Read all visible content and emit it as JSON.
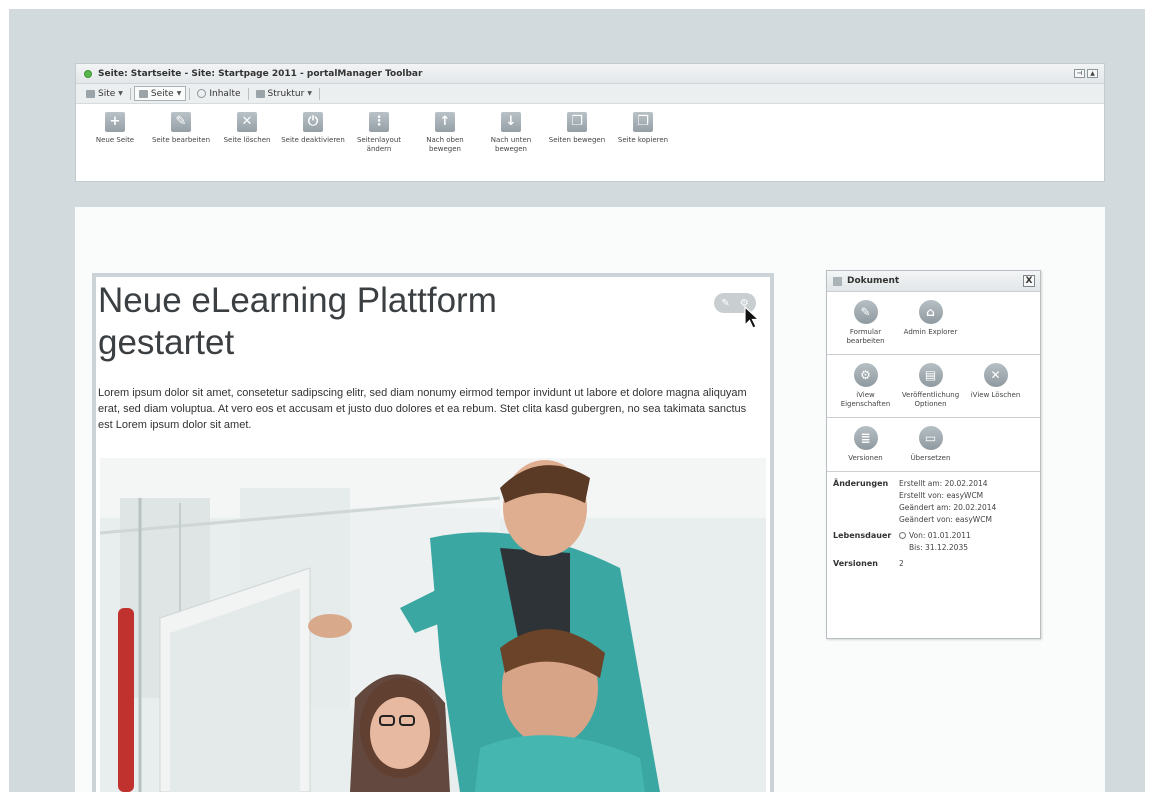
{
  "toolbar": {
    "title": "Seite: Startseite - Site: Startpage 2011 - portalManager Toolbar",
    "menu": {
      "site": "Site",
      "seite": "Seite",
      "inhalte": "Inhalte",
      "struktur": "Struktur"
    },
    "actions": [
      {
        "label": "Neue Seite",
        "icon": "plus-icon"
      },
      {
        "label": "Seite bearbeiten",
        "icon": "pencil-icon"
      },
      {
        "label": "Seite löschen",
        "icon": "x-icon"
      },
      {
        "label": "Seite deaktivieren",
        "icon": "power-icon"
      },
      {
        "label": "Seitenlayout ändern",
        "icon": "layout-icon"
      },
      {
        "label": "Nach oben bewegen",
        "icon": "arrow-up-icon"
      },
      {
        "label": "Nach unten bewegen",
        "icon": "arrow-down-icon"
      },
      {
        "label": "Seiten bewegen",
        "icon": "pages-icon"
      },
      {
        "label": "Seite kopieren",
        "icon": "copy-icon"
      }
    ]
  },
  "article": {
    "headline": "Neue eLearning Plattform gestartet",
    "body": "Lorem ipsum dolor sit amet, consetetur sadipscing elitr, sed diam nonumy eirmod tempor invidunt ut labore et dolore magna aliquyam erat, sed diam voluptua. At vero eos et accusam et justo duo dolores et ea rebum. Stet clita kasd gubergren, no sea takimata sanctus est Lorem ipsum dolor sit amet."
  },
  "dokument": {
    "title": "Dokument",
    "close": "X",
    "buttons_1": [
      {
        "label": "Formular bearbeiten",
        "icon": "pencil-circle-icon"
      },
      {
        "label": "Admin Explorer",
        "icon": "home-icon"
      }
    ],
    "buttons_2": [
      {
        "label": "iView Eigenschaften",
        "icon": "gear-icon"
      },
      {
        "label": "Veröffentlichung Optionen",
        "icon": "publish-icon"
      },
      {
        "label": "iView Löschen",
        "icon": "x-circle-icon"
      }
    ],
    "buttons_3": [
      {
        "label": "Versionen",
        "icon": "versions-icon"
      },
      {
        "label": "Übersetzen",
        "icon": "translate-icon"
      }
    ],
    "info": {
      "aenderungen_label": "Änderungen",
      "erstellt_am": "Erstellt am: 20.02.2014",
      "erstellt_von": "Erstellt von: easyWCM",
      "geaendert_am": "Geändert am: 20.02.2014",
      "geaendert_von": "Geändert von: easyWCM",
      "lebensdauer_label": "Lebensdauer",
      "von": "Von: 01.01.2011",
      "bis": "Bis: 31.12.2035",
      "versionen_label": "Versionen",
      "versionen_value": "2"
    }
  }
}
